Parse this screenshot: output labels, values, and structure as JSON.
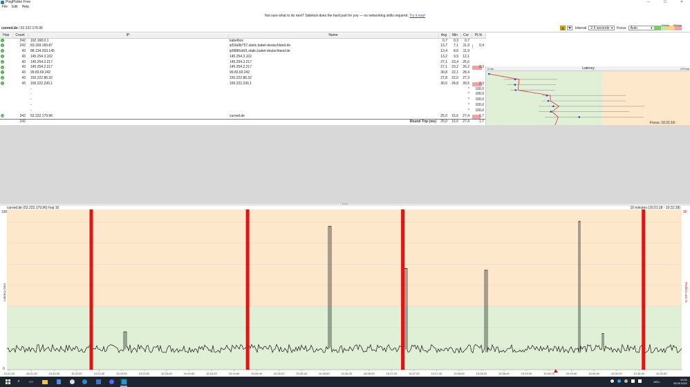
{
  "window": {
    "title": "PingPlotter Free",
    "controls": [
      "—",
      "☐",
      "✕"
    ]
  },
  "menu": [
    "File",
    "Edit",
    "Help"
  ],
  "banner": {
    "text": "Not sure what to do next? Sidekick does the hard part for you — no networking skills required.",
    "link": "Try it now!"
  },
  "target": {
    "name": "curved.de",
    "ip": "/ 52.222.179.96"
  },
  "controls": {
    "interval_label": "Interval",
    "interval_value": "2.5 seconds",
    "focus_label": "Focus",
    "focus_value": "Auto",
    "scale_left": "100ms",
    "scale_right": "500ms"
  },
  "table": {
    "columns": [
      "Hop",
      "Count",
      "IP",
      "Name",
      "Avg",
      "Min",
      "Cur",
      "PL%",
      "Latency"
    ],
    "latency_min_label": "0 ms",
    "latency_max_label": "179 ms",
    "rows": [
      {
        "hop": "1",
        "count": "242",
        "ip": "192.168.0.1",
        "name": "kabelbox",
        "avg": "0,7",
        "min": "0,3",
        "cur": "0,7",
        "pl": "",
        "plw": 0
      },
      {
        "hop": "2",
        "count": "242",
        "ip": "83.169.183.87",
        "name": "ip53a9b757.static.kabel-deutschland.de",
        "avg": "13,7",
        "min": "7,1",
        "cur": "11,9",
        "pl": "0,4",
        "plw": 0.02
      },
      {
        "hop": "3",
        "count": "43",
        "ip": "88.134.203.145",
        "name": "ip5886cb91.static.kabel-deutschland.de",
        "avg": "13,4",
        "min": "8,6",
        "cur": "11,9",
        "pl": "",
        "plw": 0
      },
      {
        "hop": "4",
        "count": "43",
        "ip": "145.254.3.102",
        "name": "145.254.3.102",
        "avg": "13,2",
        "min": "9,9",
        "cur": "12,1",
        "pl": "",
        "plw": 0
      },
      {
        "hop": "5",
        "count": "43",
        "ip": "145.254.2.217",
        "name": "145.254.2.217",
        "avg": "27,1",
        "min": "23,4",
        "cur": "25,6",
        "pl": "",
        "plw": 0
      },
      {
        "hop": "6",
        "count": "43",
        "ip": "145.254.2.217",
        "name": "145.254.2.217",
        "avg": "27,1",
        "min": "23,2",
        "cur": "26,2",
        "pl": "2,3",
        "plw": 1
      },
      {
        "hop": "7",
        "count": "43",
        "ip": "99.83.69.242",
        "name": "99.83.69.242",
        "avg": "30,8",
        "min": "22,1",
        "cur": "28,4",
        "pl": "",
        "plw": 0
      },
      {
        "hop": "8",
        "count": "43",
        "ip": "150.222.86.32",
        "name": "150.222.86.32",
        "avg": "27,8",
        "min": "22,0",
        "cur": "27,3",
        "pl": "",
        "plw": 0
      },
      {
        "hop": "9",
        "count": "43",
        "ip": "150.222.230.1",
        "name": "150.222.230.1",
        "avg": "30,5",
        "min": "24,8",
        "cur": "39,5",
        "pl": "2,3",
        "plw": 1
      },
      {
        "hop": "",
        "count": "",
        "ip": "-",
        "name": "",
        "avg": "",
        "min": "",
        "cur": "*",
        "pl": "100,0",
        "plw": 0
      },
      {
        "hop": "",
        "count": "",
        "ip": "-",
        "name": "",
        "avg": "",
        "min": "",
        "cur": "*",
        "pl": "100,0",
        "plw": 0
      },
      {
        "hop": "",
        "count": "",
        "ip": "-",
        "name": "",
        "avg": "",
        "min": "",
        "cur": "*",
        "pl": "100,0",
        "plw": 0
      },
      {
        "hop": "",
        "count": "",
        "ip": "-",
        "name": "",
        "avg": "",
        "min": "",
        "cur": "*",
        "pl": "100,0",
        "plw": 0
      },
      {
        "hop": "",
        "count": "",
        "ip": "-",
        "name": "",
        "avg": "",
        "min": "",
        "cur": "*",
        "pl": "100,0",
        "plw": 0
      },
      {
        "hop": "15",
        "count": "242",
        "ip": "52.222.179.96",
        "name": "curved.de",
        "avg": "25,0",
        "min": "15,6",
        "cur": "27,4",
        "pl": "1,7",
        "plw": 0.85
      }
    ],
    "summary": {
      "count": "242",
      "label": "Round Trip (ms)",
      "avg": "25,0",
      "min": "15,6",
      "cur": "27,4",
      "pl": "1,7"
    },
    "focus_text": "Focus: 10:21:18 - 10:31:18"
  },
  "graph": {
    "title": "curved.de (52.222.179.96) hop 15",
    "range": "10 minutes (10:21:18 - 10:31:18)",
    "y_top": "190",
    "y_bottom": "0",
    "y_label": "Latency (ms)",
    "right_top": "30",
    "right_label": "Packet Loss %",
    "xticks": [
      "10:21:20",
      "10:21:40",
      "10:22:00",
      "10:22:20",
      "10:22:40",
      "10:23:00",
      "10:23:20",
      "10:23:40",
      "10:24:00",
      "10:24:20",
      "10:24:40",
      "10:25:00",
      "10:25:20",
      "10:25:40",
      "10:26:00",
      "10:26:20",
      "10:26:40",
      "10:27:00",
      "10:27:20",
      "10:27:40",
      "10:28:00",
      "10:28:20",
      "10:28:40",
      "10:29:00",
      "10:29:20",
      "10:29:40",
      "10:30:00",
      "10:30:20",
      "10:30:40",
      "10:31:00"
    ]
  },
  "chart_data": {
    "type": "line",
    "title": "curved.de (52.222.179.96) hop 15",
    "ylabel": "Latency (ms)",
    "ylim": [
      0,
      190
    ],
    "loss_events": [
      "10:22:33",
      "10:24:52",
      "10:27:10",
      "10:30:44"
    ],
    "spikes": [
      {
        "x": "10:23:03",
        "y": 45
      },
      {
        "x": "10:26:05",
        "y": 170
      },
      {
        "x": "10:27:13",
        "y": 120
      },
      {
        "x": "10:28:24",
        "y": 118
      },
      {
        "x": "10:29:47",
        "y": 176
      },
      {
        "x": "10:30:08",
        "y": 43
      }
    ],
    "baseline": 25
  },
  "taskbar": {
    "tray_time": "10:31",
    "tray_date": "26.09.2021",
    "tray_lang": "DEU"
  },
  "colors": {
    "green_zone": "#dff0d6",
    "orange_zone": "#fde8cc",
    "loss": "#e01414",
    "hop_ok": "#3aa83a"
  }
}
